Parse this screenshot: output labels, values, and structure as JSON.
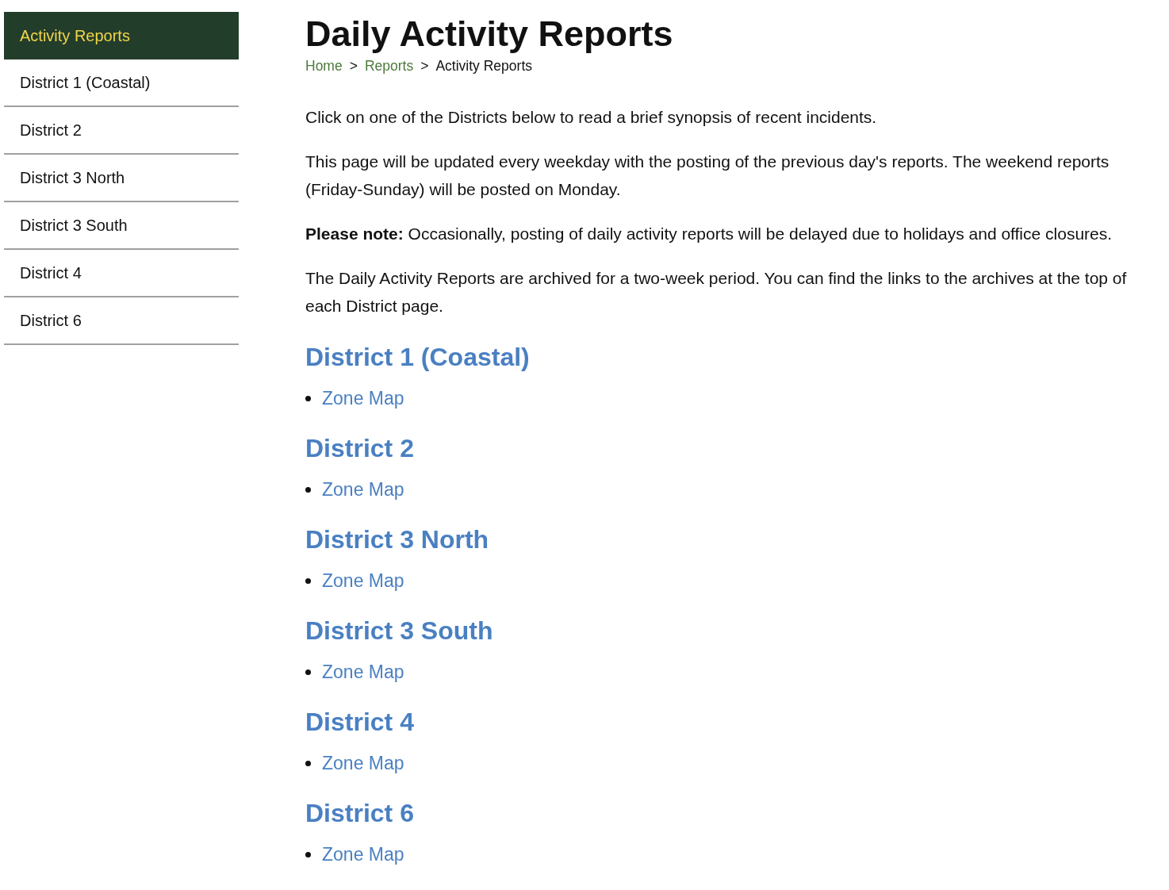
{
  "sidebar": {
    "title": "Activity Reports",
    "items": [
      {
        "label": "District 1 (Coastal)"
      },
      {
        "label": "District 2"
      },
      {
        "label": "District 3 North"
      },
      {
        "label": "District 3 South"
      },
      {
        "label": "District 4"
      },
      {
        "label": "District 6"
      }
    ]
  },
  "page": {
    "title": "Daily Activity Reports",
    "breadcrumb": [
      {
        "kind": "link",
        "text": "Home"
      },
      {
        "kind": "separator",
        "text": ">"
      },
      {
        "kind": "link",
        "text": "Reports"
      },
      {
        "kind": "separator",
        "text": ">"
      },
      {
        "kind": "current",
        "text": "Activity Reports"
      }
    ],
    "paragraphs": [
      "Click on one of the Districts below to read a brief synopsis of recent incidents.",
      "This page will be updated every weekday with the posting of the previous day's reports. The weekend reports (Friday-Sunday) will be posted on Monday.",
      "**Please note:** Occasionally, posting of daily activity reports will be delayed due to holidays and office closures.",
      "The Daily Activity Reports are archived for a two-week period. You can find the links to the archives at the top of each District page."
    ],
    "districts": [
      {
        "title": "District 1 (Coastal)",
        "links": [
          "Zone Map"
        ]
      },
      {
        "title": "District 2",
        "links": [
          "Zone Map"
        ]
      },
      {
        "title": "District 3 North",
        "links": [
          "Zone Map"
        ]
      },
      {
        "title": "District 3 South",
        "links": [
          "Zone Map"
        ]
      },
      {
        "title": "District 4",
        "links": [
          "Zone Map"
        ]
      },
      {
        "title": "District 6",
        "links": [
          "Zone Map"
        ]
      }
    ]
  }
}
